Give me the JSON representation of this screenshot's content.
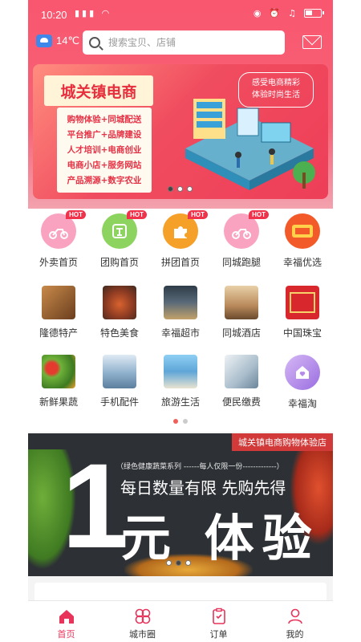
{
  "status_bar": {
    "time": "10:20"
  },
  "header": {
    "weather": {
      "temperature": "14℃"
    },
    "search": {
      "placeholder": "搜索宝贝、店铺"
    }
  },
  "banner": {
    "title": "城关镇电商",
    "lines": [
      "购物体验+同城配送",
      "平台推广+品牌建设",
      "人才培训+电商创业",
      "电商小店+服务网站",
      "产品溯源+数字农业"
    ],
    "slogan_1": "感受电商精彩",
    "slogan_2": "体验时尚生活"
  },
  "grid": {
    "hot_label": "HOT",
    "items": [
      {
        "label": "外卖首页",
        "icon": "scooter-icon",
        "color": "#f9a3c0",
        "hot": true
      },
      {
        "label": "团购首页",
        "icon": "group-buy-icon",
        "color": "#8dd35f",
        "hot": true
      },
      {
        "label": "拼团首页",
        "icon": "puzzle-icon",
        "color": "#f5a028",
        "hot": true
      },
      {
        "label": "同城跑腿",
        "icon": "delivery-icon",
        "color": "#f9a3c0",
        "hot": true
      },
      {
        "label": "幸福优选",
        "icon": "save-money-icon",
        "color": "#f35a2a",
        "hot": false
      },
      {
        "label": "隆德特产",
        "icon": "specialty-food-icon",
        "color": "#7a5a3a",
        "hot": false
      },
      {
        "label": "特色美食",
        "icon": "hotpot-icon",
        "color": "#b3543a",
        "hot": false
      },
      {
        "label": "幸福超市",
        "icon": "supermarket-icon",
        "color": "#3c4a56",
        "hot": false
      },
      {
        "label": "同城酒店",
        "icon": "hotel-icon",
        "color": "#d8b68a",
        "hot": false
      },
      {
        "label": "中国珠宝",
        "icon": "jewelry-icon",
        "color": "#d8282e",
        "hot": false
      },
      {
        "label": "新鲜果蔬",
        "icon": "vegetables-icon",
        "color": "#5e9e3a",
        "hot": false
      },
      {
        "label": "手机配件",
        "icon": "phone-accessory-icon",
        "color": "#7fa8c9",
        "hot": false
      },
      {
        "label": "旅游生活",
        "icon": "travel-icon",
        "color": "#5fa6d8",
        "hot": false
      },
      {
        "label": "便民缴费",
        "icon": "payment-icon",
        "color": "#9db3c4",
        "hot": false
      },
      {
        "label": "幸福淘",
        "icon": "home-heart-icon",
        "color": "#b78ce8",
        "hot": false
      }
    ]
  },
  "promo": {
    "tag": "城关镇电商购物体验店",
    "sub": "（绿色健康蔬菜系列 ------每人仅限一份-------------）",
    "big_number": "1",
    "line1": "每日数量有限  先购先得",
    "line2": "元 体验"
  },
  "tabbar": {
    "tabs": [
      {
        "label": "首页",
        "icon": "home-icon",
        "active": true
      },
      {
        "label": "城市圈",
        "icon": "city-circle-icon",
        "active": false
      },
      {
        "label": "订单",
        "icon": "order-icon",
        "active": false
      },
      {
        "label": "我的",
        "icon": "profile-icon",
        "active": false
      }
    ]
  },
  "colors": {
    "primary": "#f9566f",
    "active_tab": "#e8335a"
  }
}
